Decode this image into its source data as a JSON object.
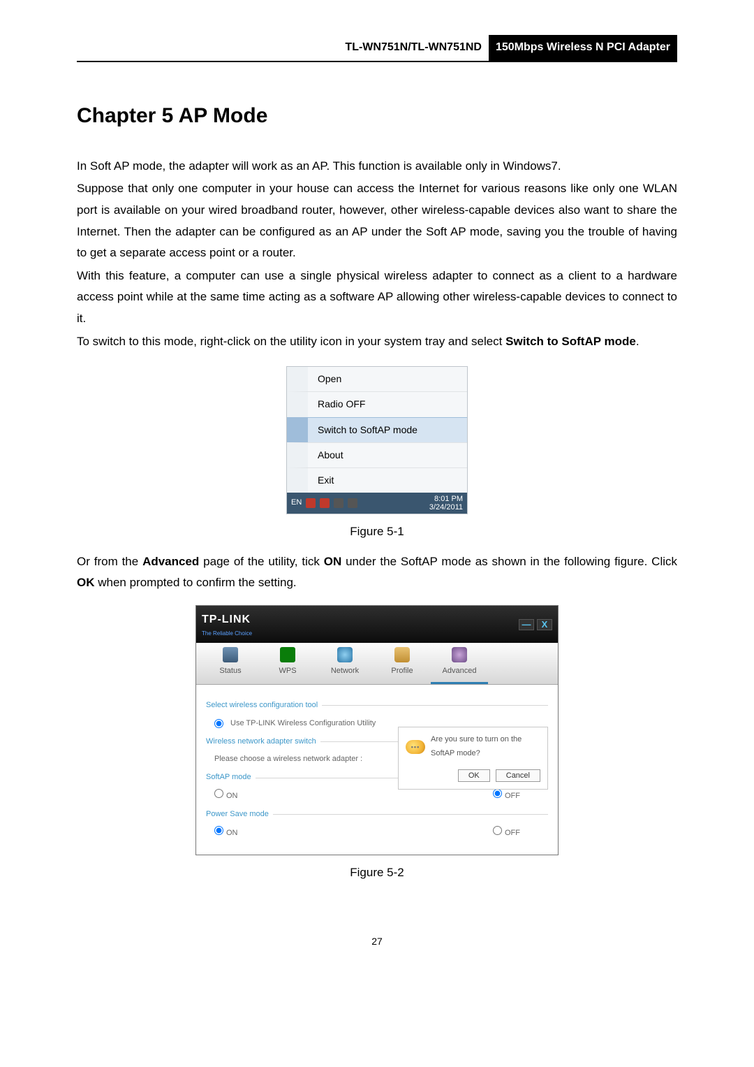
{
  "header": {
    "left": "TL-WN751N/TL-WN751ND",
    "right": "150Mbps Wireless N PCI Adapter"
  },
  "chapter": "Chapter 5   AP Mode",
  "para1": "In Soft AP mode, the adapter will work as an AP. This function is available only in Windows7.",
  "para2": "Suppose that only one computer in your house can access the Internet for various reasons like only one WLAN port is available on your wired broadband router, however, other wireless-capable devices also want to share the Internet. Then the adapter can be configured as an AP under the Soft AP mode, saving you the trouble of having to get a separate access point or a router.",
  "para3": "With this feature, a computer can use a single physical wireless adapter to connect as a client to a hardware access point while at the same time acting as a software AP allowing other wireless-capable devices to connect to it.",
  "para4_pre": "To switch to this mode, right-click on the utility icon in your system tray and select ",
  "para4_bold": "Switch to SoftAP mode",
  "para4_post": ".",
  "menu": {
    "open": "Open",
    "radio_off": "Radio OFF",
    "switch": "Switch to SoftAP mode",
    "about": "About",
    "exit": "Exit",
    "lang": "EN",
    "time": "8:01 PM",
    "date": "3/24/2011"
  },
  "fig1_caption": "Figure 5-1",
  "para5_pre": "Or from the ",
  "para5_b1": "Advanced",
  "para5_mid1": " page of the utility, tick ",
  "para5_b2": "ON",
  "para5_mid2": " under the SoftAP mode as shown in the following figure. Click ",
  "para5_b3": "OK",
  "para5_post": " when prompted to confirm the setting.",
  "utility": {
    "brand": "TP-LINK",
    "subbrand": "The Reliable Choice",
    "tabs": {
      "status": "Status",
      "wps": "WPS",
      "network": "Network",
      "profile": "Profile",
      "advanced": "Advanced"
    },
    "group1": "Select wireless configuration tool",
    "opt_use_tplink": "Use TP-LINK Wireless Configuration Utility",
    "group2": "Wireless network adapter switch",
    "adapter_text": "Please choose a wireless network adapter :",
    "group3": "SoftAP mode",
    "group4": "Power Save mode",
    "on": "ON",
    "off": "OFF",
    "dialog_msg": "Are you sure to turn on the SoftAP mode?",
    "ok": "OK",
    "cancel": "Cancel",
    "min": "—",
    "close": "X"
  },
  "fig2_caption": "Figure 5-2",
  "page_number": "27"
}
